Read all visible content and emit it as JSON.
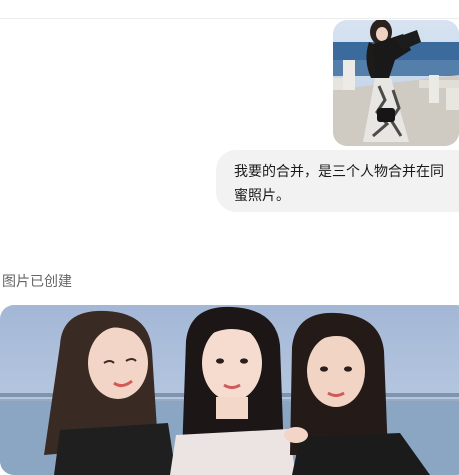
{
  "chat": {
    "user_message_line1": "我要的合并，是三个人物合并在同",
    "user_message_line2": "蜜照片。",
    "status_text": "图片已创建"
  },
  "images": {
    "uploaded_thumb": "photo of a woman in a floral dress on a seaside promenade",
    "generated_image": "photo of three smiling women posing together by the sea"
  },
  "colors": {
    "bubble_bg": "#f2f2f2",
    "status_text": "#666666",
    "sky": "#a9bcd8",
    "sea": "#8aa6c2"
  }
}
